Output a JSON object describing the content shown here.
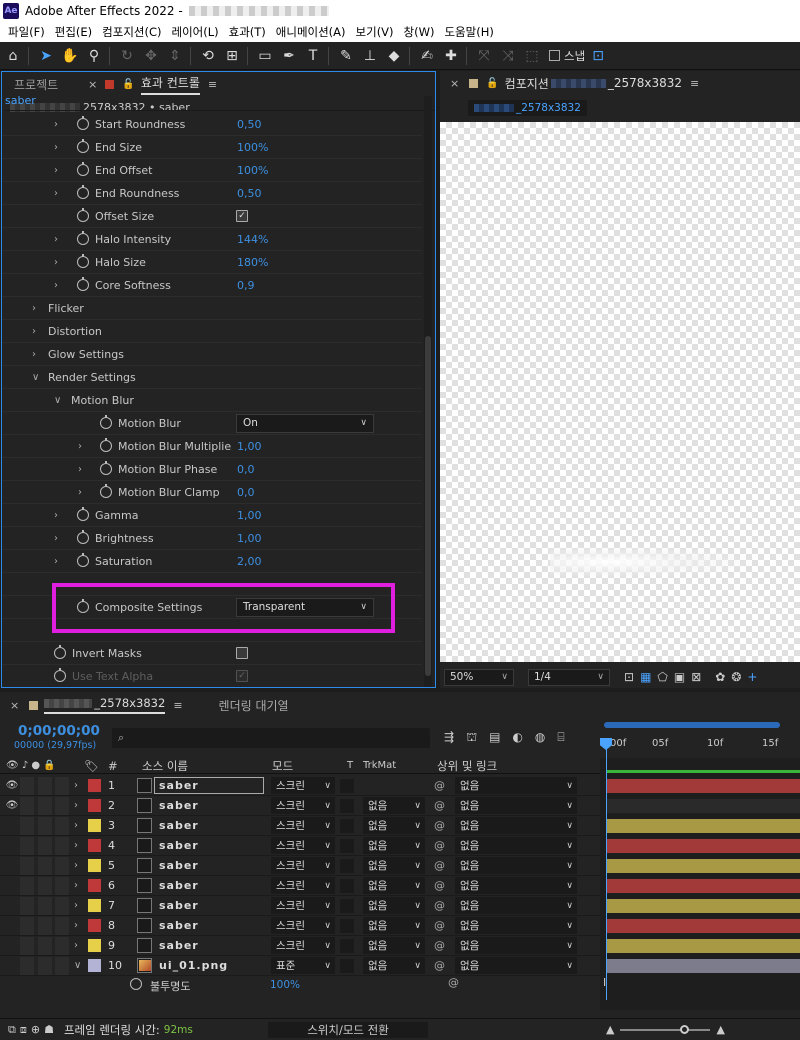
{
  "window": {
    "title": "Adobe After Effects 2022 - ",
    "logo": "Ae"
  },
  "menu": [
    "파일(F)",
    "편집(E)",
    "컴포지션(C)",
    "레이어(L)",
    "효과(T)",
    "애니메이션(A)",
    "보기(V)",
    "창(W)",
    "도움말(H)"
  ],
  "toolbar": {
    "snap_label": "스냅"
  },
  "effect_panel": {
    "tab_project": "프로젝트",
    "tab_effects": "효과 컨트롤",
    "layer_name": "saber",
    "subtitle": "2578x3832 • saber",
    "rows": [
      {
        "label": "Start Roundness",
        "value": "0,50"
      },
      {
        "label": "End Size",
        "value": "100%"
      },
      {
        "label": "End Offset",
        "value": "100%"
      },
      {
        "label": "End Roundness",
        "value": "0,50"
      },
      {
        "label": "Offset Size",
        "value": "✓"
      },
      {
        "label": "Halo Intensity",
        "value": "144%"
      },
      {
        "label": "Halo Size",
        "value": "180%"
      },
      {
        "label": "Core Softness",
        "value": "0,9"
      },
      {
        "label": "Flicker",
        "value": ""
      },
      {
        "label": "Distortion",
        "value": ""
      },
      {
        "label": "Glow Settings",
        "value": ""
      },
      {
        "label": "Render Settings",
        "value": ""
      },
      {
        "label": "Motion Blur",
        "value": ""
      },
      {
        "label": "Motion Blur",
        "value": "On"
      },
      {
        "label": "Motion Blur Multiplie",
        "value": "1,00"
      },
      {
        "label": "Motion Blur Phase",
        "value": "0,0"
      },
      {
        "label": "Motion Blur Clamp",
        "value": "0,0"
      },
      {
        "label": "Gamma",
        "value": "1,00"
      },
      {
        "label": "Brightness",
        "value": "1,00"
      },
      {
        "label": "Saturation",
        "value": "2,00"
      },
      {
        "label": "Composite Settings",
        "value": "Transparent"
      },
      {
        "label": "Invert Masks",
        "value": ""
      },
      {
        "label": "Use Text Alpha",
        "value": "✓"
      }
    ]
  },
  "composition_panel": {
    "tab_title": "컴포지션",
    "tab_suffix": "_2578x3832",
    "pill_suffix": "_2578x3832",
    "zoom": "50%",
    "resolution": "1/4"
  },
  "timeline": {
    "tab_suffix": "_2578x3832",
    "render_queue": "렌더링 대기열",
    "timecode": "0;00;00;00",
    "fps": "00000 (29,97fps)",
    "search_placeholder": "⌕",
    "columns": {
      "source_name": "소스 이름",
      "mode": "모드",
      "t": "T",
      "trkmat": "TrkMat",
      "parent": "상위 및 링크"
    },
    "ruler_ticks": [
      "00f",
      "05f",
      "10f",
      "15f"
    ],
    "layers": [
      {
        "num": "1",
        "name": "saber",
        "label_color": "#c0393a",
        "mode": "스크린",
        "trkmat": "",
        "parent": "없음",
        "bar_color": "#a33a3a"
      },
      {
        "num": "2",
        "name": "saber",
        "label_color": "#c0393a",
        "mode": "스크린",
        "trkmat": "없음",
        "parent": "없음",
        "bar_color": "#2a2a2a"
      },
      {
        "num": "3",
        "name": "saber",
        "label_color": "#e6d04a",
        "mode": "스크린",
        "trkmat": "없음",
        "parent": "없음",
        "bar_color": "#a89a45"
      },
      {
        "num": "4",
        "name": "saber",
        "label_color": "#c0393a",
        "mode": "스크린",
        "trkmat": "없음",
        "parent": "없음",
        "bar_color": "#a33a3a"
      },
      {
        "num": "5",
        "name": "saber",
        "label_color": "#e6d04a",
        "mode": "스크린",
        "trkmat": "없음",
        "parent": "없음",
        "bar_color": "#a89a45"
      },
      {
        "num": "6",
        "name": "saber",
        "label_color": "#c0393a",
        "mode": "스크린",
        "trkmat": "없음",
        "parent": "없음",
        "bar_color": "#a33a3a"
      },
      {
        "num": "7",
        "name": "saber",
        "label_color": "#e6d04a",
        "mode": "스크린",
        "trkmat": "없음",
        "parent": "없음",
        "bar_color": "#a89a45"
      },
      {
        "num": "8",
        "name": "saber",
        "label_color": "#c0393a",
        "mode": "스크린",
        "trkmat": "없음",
        "parent": "없음",
        "bar_color": "#a33a3a"
      },
      {
        "num": "9",
        "name": "saber",
        "label_color": "#e6d04a",
        "mode": "스크린",
        "trkmat": "없음",
        "parent": "없음",
        "bar_color": "#a89a45"
      },
      {
        "num": "10",
        "name": "ui_01.png",
        "label_color": "#b3b3d6",
        "mode": "표준",
        "trkmat": "없음",
        "parent": "없음",
        "bar_color": "#7c7c8c"
      }
    ],
    "opacity_label": "불투명도",
    "opacity_value": "100%"
  },
  "status": {
    "render_time_label": "프레임 렌더링 시간:",
    "render_time_value": "92ms",
    "toggle_label": "스위치/모드 전환"
  }
}
